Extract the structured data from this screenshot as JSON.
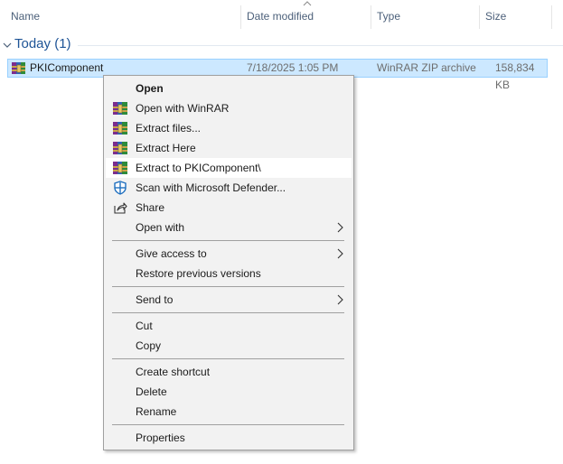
{
  "columns": {
    "name": "Name",
    "date_modified": "Date modified",
    "type": "Type",
    "size": "Size",
    "sort_indicator": "chevron-up-icon"
  },
  "group": {
    "label": "Today (1)",
    "icon": "chevron-down-icon"
  },
  "file": {
    "name": "PKIComponent",
    "date_modified": "7/18/2025 1:05 PM",
    "type": "WinRAR ZIP archive",
    "size": "158,834 KB",
    "icon": "winrar-archive-icon",
    "selected": true
  },
  "context_menu": {
    "items": {
      "open": "Open",
      "open_with_winrar": "Open with WinRAR",
      "extract_files": "Extract files...",
      "extract_here": "Extract Here",
      "extract_to": "Extract to PKIComponent\\",
      "scan_defender": "Scan with Microsoft Defender...",
      "share": "Share",
      "open_with": "Open with",
      "give_access_to": "Give access to",
      "restore_previous_versions": "Restore previous versions",
      "send_to": "Send to",
      "cut": "Cut",
      "copy": "Copy",
      "create_shortcut": "Create shortcut",
      "delete": "Delete",
      "rename": "Rename",
      "properties": "Properties"
    },
    "highlighted_item": "extract_to"
  },
  "colors": {
    "selection_bg": "#cce8ff",
    "selection_border": "#99d1ff",
    "group_text": "#1e5496",
    "menu_bg": "#f2f2f2",
    "menu_hover": "#ffffff"
  }
}
